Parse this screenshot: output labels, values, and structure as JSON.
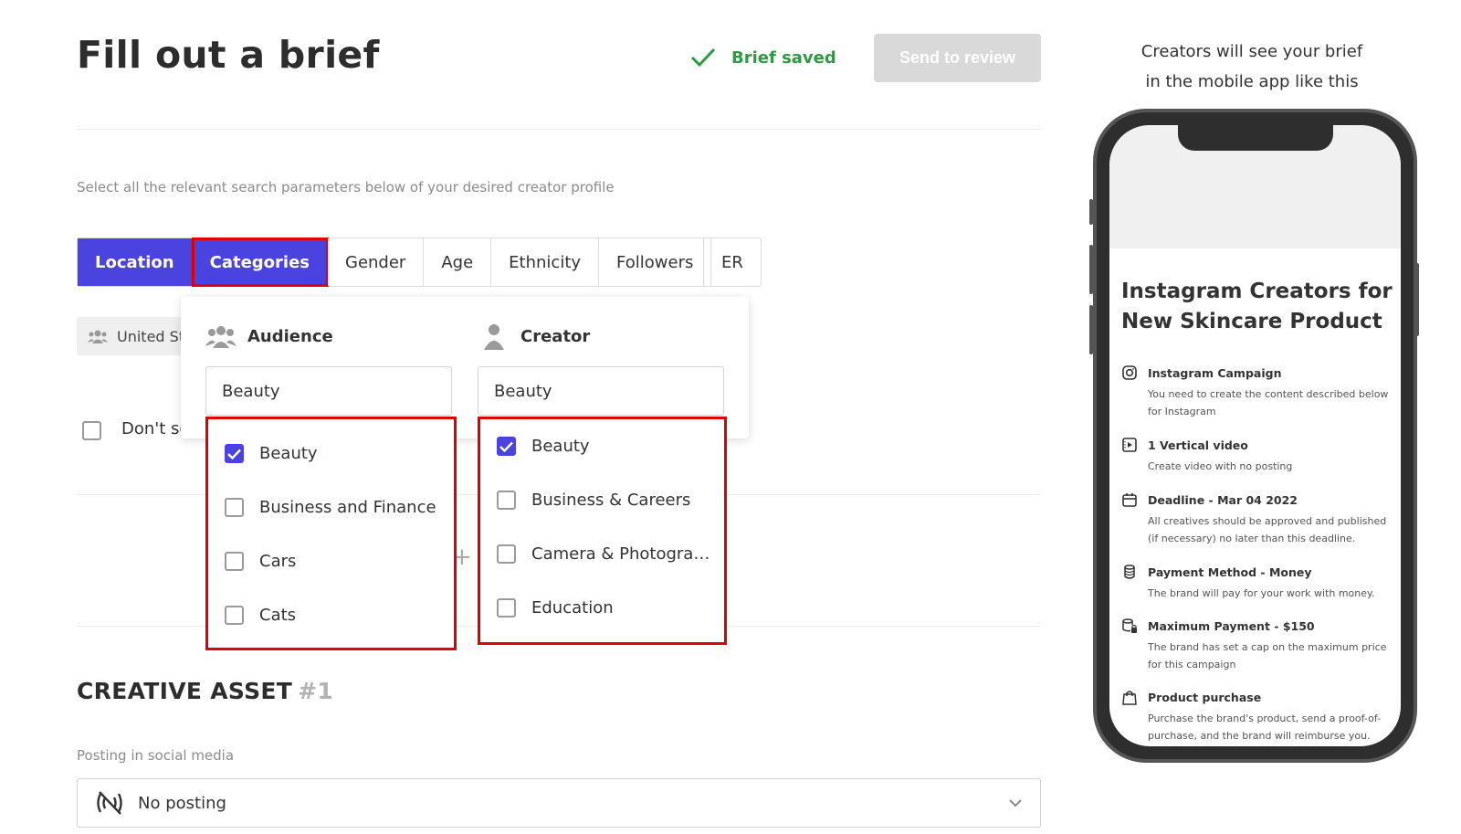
{
  "header": {
    "title": "Fill out a brief",
    "saved_status": "Brief saved",
    "send_button": "Send to review"
  },
  "search": {
    "hint": "Select all the relevant search parameters below of your desired creator profile",
    "tabs": [
      {
        "label": "Location",
        "active": true
      },
      {
        "label": "Categories",
        "active": true
      },
      {
        "label": "Gender",
        "active": false
      },
      {
        "label": "Age",
        "active": false
      },
      {
        "label": "Ethnicity",
        "active": false
      },
      {
        "label": "Followers",
        "active": false
      }
    ],
    "er_tab": "ER",
    "location_chip": "United States",
    "dont_send_label": "Don't send"
  },
  "categories_popup": {
    "audience": {
      "heading": "Audience",
      "search_value": "Beauty",
      "options": [
        {
          "label": "Beauty",
          "checked": true
        },
        {
          "label": "Business and Finance",
          "checked": false
        },
        {
          "label": "Cars",
          "checked": false
        },
        {
          "label": "Cats",
          "checked": false
        }
      ]
    },
    "creator": {
      "heading": "Creator",
      "search_value": "Beauty",
      "options": [
        {
          "label": "Beauty",
          "checked": true
        },
        {
          "label": "Business & Careers",
          "checked": false
        },
        {
          "label": "Camera & Photogra…",
          "checked": false
        },
        {
          "label": "Education",
          "checked": false
        }
      ]
    }
  },
  "creative_asset": {
    "title": "CREATIVE ASSET",
    "number": "#1",
    "posting_label": "Posting in social media",
    "posting_value": "No posting"
  },
  "preview": {
    "caption_line1": "Creators will see your brief",
    "caption_line2": "in the mobile app like this",
    "campaign_title": "Instagram Creators for New Skincare Product",
    "features": [
      {
        "icon": "instagram-icon",
        "title": "Instagram Campaign",
        "desc": "You need to create the content described below for Instagram"
      },
      {
        "icon": "video-icon",
        "title": "1 Vertical video",
        "desc": "Create video with no posting"
      },
      {
        "icon": "calendar-icon",
        "title": "Deadline - Mar 04 2022",
        "desc": "All creatives should be approved and published (if necessary) no later than this deadline."
      },
      {
        "icon": "coins-icon",
        "title": "Payment Method - Money",
        "desc": "The brand will pay for your work with money."
      },
      {
        "icon": "coins-lock-icon",
        "title": "Maximum Payment - $150",
        "desc": "The brand has set a cap on the maximum price for this campaign"
      },
      {
        "icon": "shopping-bag-icon",
        "title": "Product purchase",
        "desc": "Purchase the brand's product, send a proof-of-purchase, and the brand will reimburse you."
      }
    ]
  },
  "colors": {
    "accent": "#4a43e0",
    "saved_green": "#2f9a45",
    "highlight_red": "#e00000"
  }
}
